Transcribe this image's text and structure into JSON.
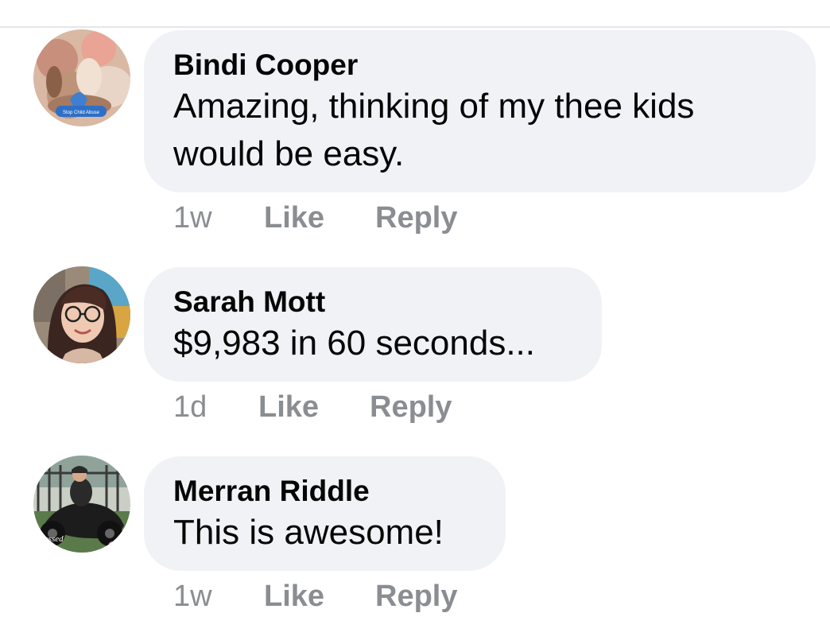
{
  "comments": [
    {
      "author": "Bindi Cooper",
      "text": "Amazing, thinking of my thee kids would be easy.",
      "time": "1w",
      "like_label": "Like",
      "reply_label": "Reply",
      "avatar_badge_text": "Stop Child Abuse"
    },
    {
      "author": "Sarah Mott",
      "text": "$9,983 in 60 seconds...",
      "time": "1d",
      "like_label": "Like",
      "reply_label": "Reply"
    },
    {
      "author": "Merran Riddle",
      "text": "This is awesome!",
      "time": "1w",
      "like_label": "Like",
      "reply_label": "Reply",
      "avatar_caption_text": "Blessed"
    }
  ],
  "colors": {
    "bubble_background": "#f0f2f5",
    "author_text": "#050505",
    "meta_text": "#8a8d91",
    "divider": "#e4e6eb"
  }
}
